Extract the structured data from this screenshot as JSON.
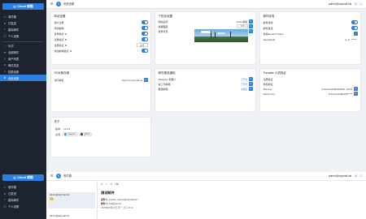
{
  "app": {
    "name": "Cloud 邮箱",
    "logo_icon": "mail-icon"
  },
  "colors": {
    "accent": "#2f7fe0",
    "sidebar_bg": "#1d2430",
    "page_bg": "#eef1f5"
  },
  "sidebar_top": {
    "items": [
      {
        "label": "收件箱",
        "icon": "inbox-icon"
      },
      {
        "label": "已发送",
        "icon": "send-icon"
      },
      {
        "label": "星标邮件",
        "icon": "star-icon"
      },
      {
        "label": "个人设置",
        "icon": "user-icon"
      }
    ],
    "section_label": "管理",
    "admin_items": [
      {
        "label": "全部邮件",
        "icon": "mail-icon"
      },
      {
        "label": "用户列表",
        "icon": "users-icon"
      },
      {
        "label": "邮件发送",
        "icon": "send-icon"
      },
      {
        "label": "权限设置",
        "icon": "shield-icon"
      },
      {
        "label": "系统设置",
        "icon": "gear-icon",
        "active": true
      }
    ]
  },
  "topbar": {
    "title": "系统设置",
    "email": "admin@skymail.ink",
    "menu_icon": "menu-icon",
    "edit_icon": "pen-icon"
  },
  "cards": {
    "site": {
      "title": "网站设置",
      "rows": [
        {
          "label": "用户注册",
          "type": "toggle",
          "on": true
        },
        {
          "label": "添加邮箱",
          "type": "toggle",
          "on": true
        },
        {
          "label": "多号模式",
          "type": "toggle",
          "on": true,
          "help": true
        },
        {
          "label": "注册验证",
          "type": "toggle",
          "on": true,
          "help": true
        },
        {
          "label": "注册验证",
          "type": "select",
          "value": "关闭",
          "help": true
        },
        {
          "label": "添加邮箱验证",
          "type": "toggle",
          "on": true,
          "help": true
        }
      ]
    },
    "personal": {
      "title": "个性化设置",
      "rows": [
        {
          "label": "网站名称",
          "value": "Cloud 邮箱"
        },
        {
          "label": "模糊程度",
          "value": "100"
        },
        {
          "label": "登录背景",
          "value": ""
        }
      ]
    },
    "mail": {
      "title": "邮件收发",
      "rows": [
        {
          "label": "邮件接收",
          "type": "toggle",
          "on": true
        },
        {
          "label": "邮件发送",
          "type": "toggle",
          "on": true
        },
        {
          "label": "添加Resend Token",
          "type": "add"
        },
        {
          "label": "skymail.ink",
          "value": "re_P...******"
        }
      ]
    },
    "r2": {
      "title": "R2对象存储",
      "rows": [
        {
          "label": "访问域名",
          "value": "https://r2.skymail.ink"
        }
      ]
    },
    "push": {
      "title": "邮件推送通知",
      "rows": [
        {
          "label": "Telegram 机器人",
          "value": "已开启"
        },
        {
          "label": "第三方邮箱",
          "value": "已开启"
        },
        {
          "label": "推送邮箱",
          "value": "未绑定"
        }
      ]
    },
    "turnstile": {
      "title": "Turnstile 人机验证",
      "rows": [
        {
          "label": "注册验证",
          "type": "toggle",
          "on": true
        },
        {
          "label": "添加验证",
          "type": "toggle",
          "on": true
        },
        {
          "label": "Site Key",
          "value": "0x4AAAAAABv0K8iSP...L6Cfs"
        },
        {
          "label": "Secret Key",
          "value": "0x4AAAAAABv0K8*****"
        }
      ]
    },
    "about": {
      "title": "关于",
      "rows": [
        {
          "label": "版本:",
          "value": "v1.3.3"
        },
        {
          "label": "交流:",
          "chips": [
            "telegram",
            "github"
          ]
        }
      ]
    }
  },
  "bottom": {
    "app": {
      "name": "Cloud 邮箱"
    },
    "sidebar_items": [
      {
        "label": "收件箱",
        "icon": "inbox-icon"
      },
      {
        "label": "已发送",
        "icon": "send-icon"
      },
      {
        "label": "星标邮件",
        "icon": "star-icon"
      },
      {
        "label": "个人设置",
        "icon": "user-icon"
      }
    ],
    "topbar": {
      "title": "收件箱",
      "email": "admin@skymail.ink"
    },
    "list": [
      {
        "title": "admin@skymail.ink",
        "badge": "TS"
      },
      {
        "title": "admin@skymail.ink"
      }
    ],
    "message": {
      "subject": "测试邮件",
      "from_label": "发件人:",
      "from": "junction <admin@skymail.ink>",
      "to_label": "收件人:",
      "to": "test@qq.com",
      "time": "2025年05月25日 周一 上午 02:13"
    }
  }
}
